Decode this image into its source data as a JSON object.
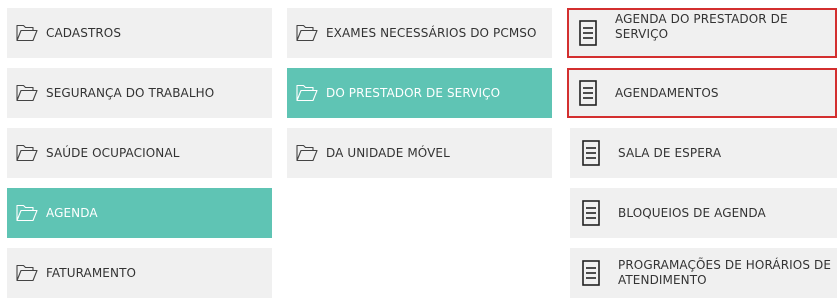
{
  "column_1": [
    {
      "label": "CADASTROS",
      "active": false
    },
    {
      "label": "SEGURANÇA DO TRABALHO",
      "active": false
    },
    {
      "label": "SAÚDE OCUPACIONAL",
      "active": false
    },
    {
      "label": "AGENDA",
      "active": true
    },
    {
      "label": "FATURAMENTO",
      "active": false
    }
  ],
  "column_2": [
    {
      "label": "EXAMES NECESSÁRIOS DO PCMSO",
      "active": false
    },
    {
      "label": "DO PRESTADOR DE SERVIÇO",
      "active": true
    },
    {
      "label": "DA UNIDADE MÓVEL",
      "active": false
    }
  ],
  "column_3": [
    {
      "label": "AGENDA DO PRESTADOR DE SERVIÇO",
      "highlighted": true
    },
    {
      "label": "AGENDAMENTOS",
      "highlighted": true
    },
    {
      "label": "SALA DE ESPERA",
      "highlighted": false
    },
    {
      "label": "BLOQUEIOS DE AGENDA",
      "highlighted": false
    },
    {
      "label": "PROGRAMAÇÕES DE HORÁRIOS DE ATENDIMENTO",
      "highlighted": false
    }
  ],
  "icons": {
    "folder": "folder-icon",
    "document": "document-icon"
  },
  "colors": {
    "tile_background": "#f0f0f0",
    "active_background": "#5fc4b4",
    "highlight_border": "#d32f2f",
    "text": "#333333"
  }
}
